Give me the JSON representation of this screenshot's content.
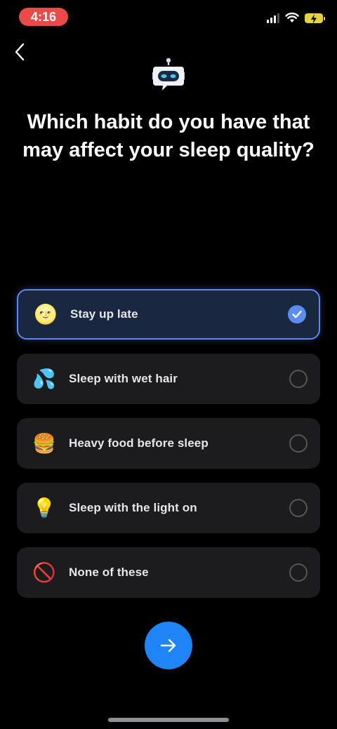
{
  "status_bar": {
    "time": "4:16",
    "icons": [
      "cellular-signal-icon",
      "wifi-icon",
      "battery-charging-icon"
    ]
  },
  "header": {
    "back_icon": "chevron-left-icon",
    "avatar_icon": "robot-icon",
    "title": "Which habit do you have that may affect your sleep quality?"
  },
  "options": [
    {
      "emoji": "🌝",
      "label": "Stay up late",
      "selected": true
    },
    {
      "emoji": "💦",
      "label": "Sleep with wet hair",
      "selected": false
    },
    {
      "emoji": "🍔",
      "label": "Heavy food before sleep",
      "selected": false
    },
    {
      "emoji": "💡",
      "label": "Sleep with the light on",
      "selected": false
    },
    {
      "emoji": "🚫",
      "label": "None of these",
      "selected": false
    }
  ],
  "footer": {
    "next_icon": "arrow-right-icon"
  },
  "colors": {
    "background": "#000000",
    "card": "#1c1c1e",
    "selected_card": "#1a2740",
    "selected_border": "#5f86f0",
    "accent": "#1f84f5",
    "time_pill": "#eb4a4a"
  }
}
